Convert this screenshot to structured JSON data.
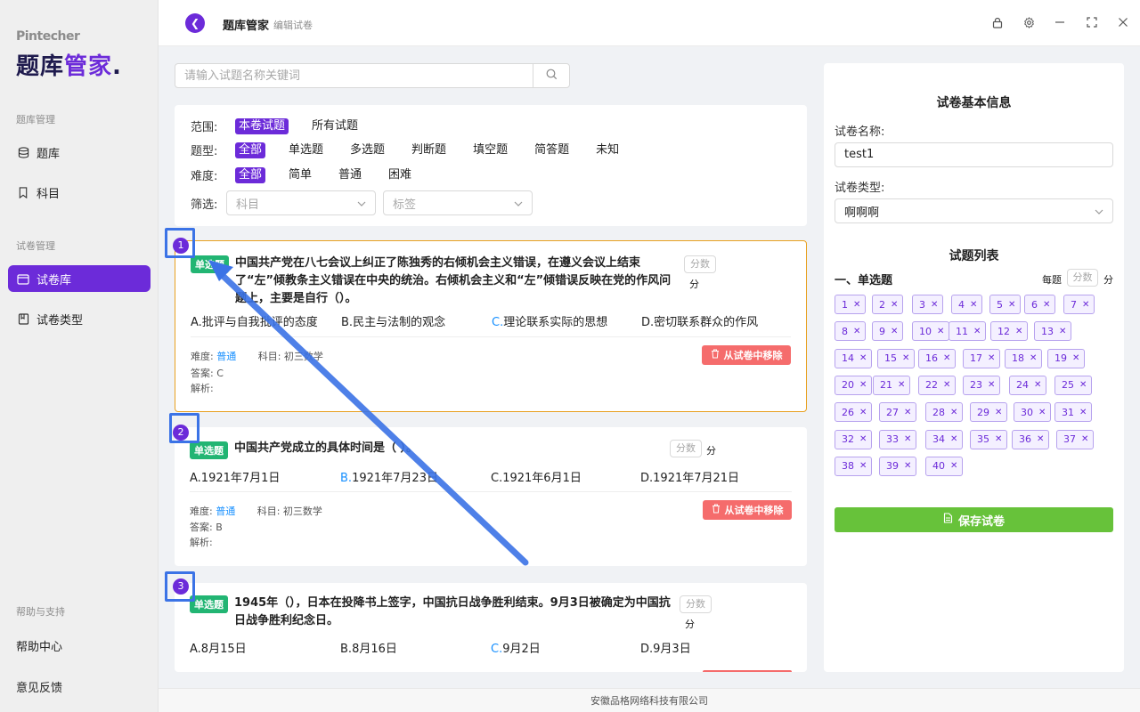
{
  "brand": {
    "small": "Pintecher",
    "big_main": "题库",
    "big_accent": "管家",
    "big_dot": "."
  },
  "sidebar": {
    "sections": [
      {
        "title": "题库管理",
        "items": [
          {
            "label": "题库",
            "icon": "database-icon"
          },
          {
            "label": "科目",
            "icon": "bookmark-icon"
          }
        ]
      },
      {
        "title": "试卷管理",
        "items": [
          {
            "label": "试卷库",
            "icon": "folder-icon"
          },
          {
            "label": "试卷类型",
            "icon": "book-icon"
          }
        ]
      },
      {
        "title": "帮助与支持",
        "items": [
          {
            "label": "帮助中心"
          },
          {
            "label": "意见反馈"
          }
        ]
      }
    ]
  },
  "topbar": {
    "title": "题库管家",
    "subtitle": "编辑试卷"
  },
  "search": {
    "placeholder": "请输入试题名称关键词"
  },
  "filters": {
    "scope": {
      "label": "范围:",
      "options": [
        "本卷试题",
        "所有试题"
      ],
      "selected": 0
    },
    "type": {
      "label": "题型:",
      "options": [
        "全部",
        "单选题",
        "多选题",
        "判断题",
        "填空题",
        "简答题",
        "未知"
      ],
      "selected": 0
    },
    "difficulty": {
      "label": "难度:",
      "options": [
        "全部",
        "简单",
        "普通",
        "困难"
      ],
      "selected": 0
    },
    "screen": {
      "label": "筛选:",
      "subject_placeholder": "科目",
      "tag_placeholder": "标签"
    }
  },
  "questions": [
    {
      "number": "1",
      "type": "单选题",
      "text": "中国共产党在八七会议上纠正了陈独秀的右倾机会主义错误，在遵义会议上结束了“左”倾教条主义错误在中央的统治。右倾机会主义和“左”倾错误反映在党的作风问题上，主要是自行（）。",
      "options": [
        {
          "letter": "A.",
          "text": "批评与自我批评的态度"
        },
        {
          "letter": "B.",
          "text": "民主与法制的观念"
        },
        {
          "letter": "C.",
          "text": "理论联系实际的思想"
        },
        {
          "letter": "D.",
          "text": "密切联系群众的作风"
        }
      ],
      "correct": "C",
      "difficulty_label": "难度:",
      "difficulty": "普通",
      "subject_label": "科目:",
      "subject": "初三数学",
      "answer_label": "答案:",
      "answer": "C",
      "analysis_label": "解析:",
      "score_placeholder": "分数",
      "score_unit": "分",
      "remove_label": "从试卷中移除"
    },
    {
      "number": "2",
      "type": "单选题",
      "text": "中国共产党成立的具体时间是（ ）。",
      "options": [
        {
          "letter": "A.",
          "text": "1921年7月1日"
        },
        {
          "letter": "B.",
          "text": "1921年7月23日"
        },
        {
          "letter": "C.",
          "text": "1921年6月1日"
        },
        {
          "letter": "D.",
          "text": "1921年7月21日"
        }
      ],
      "correct": "B",
      "difficulty_label": "难度:",
      "difficulty": "普通",
      "subject_label": "科目:",
      "subject": "初三数学",
      "answer_label": "答案:",
      "answer": "B",
      "analysis_label": "解析:",
      "score_placeholder": "分数",
      "score_unit": "分",
      "remove_label": "从试卷中移除"
    },
    {
      "number": "3",
      "type": "单选题",
      "text": "1945年（），日本在投降书上签字，中国抗日战争胜利结束。9月3日被确定为中国抗日战争胜利纪念日。",
      "options": [
        {
          "letter": "A.",
          "text": "8月15日"
        },
        {
          "letter": "B.",
          "text": "8月16日"
        },
        {
          "letter": "C.",
          "text": "9月2日"
        },
        {
          "letter": "D.",
          "text": "9月3日"
        }
      ],
      "correct": "C",
      "score_placeholder": "分数",
      "score_unit": "分"
    }
  ],
  "paper_info": {
    "title": "试卷基本信息",
    "name_label": "试卷名称:",
    "name_value": "test1",
    "type_label": "试卷类型:",
    "type_value": "啊啊啊",
    "list_title": "试题列表",
    "section_heading": "一、单选题",
    "per_question_label": "每题",
    "per_question_placeholder": "分数",
    "per_question_unit": "分",
    "question_numbers": [
      "1",
      "2",
      "3",
      "4",
      "5",
      "6",
      "7",
      "8",
      "9",
      "10",
      "11",
      "12",
      "13",
      "14",
      "15",
      "16",
      "17",
      "18",
      "19",
      "20",
      "21",
      "22",
      "23",
      "24",
      "25",
      "26",
      "27",
      "28",
      "29",
      "30",
      "31",
      "32",
      "33",
      "34",
      "35",
      "36",
      "37",
      "38",
      "39",
      "40"
    ],
    "save_label": "保存试卷"
  },
  "footer": {
    "company": "安徽品格网络科技有限公司"
  },
  "colors": {
    "accent": "#6c2bd9",
    "badge": "#22b573",
    "remove": "#f56c6c",
    "save": "#67c23a",
    "highlight_border": "#e8a020",
    "annotation": "#3b73e6"
  }
}
